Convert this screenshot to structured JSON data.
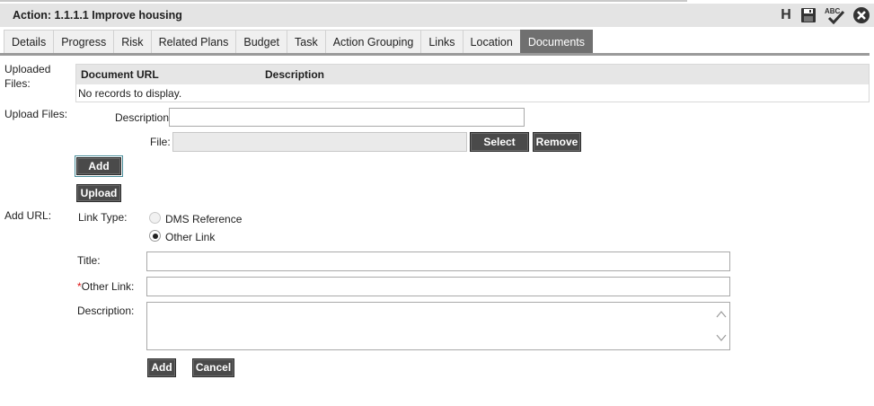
{
  "window": {
    "title": "Action: 1.1.1.1 Improve housing",
    "toolbar": {
      "h_label": "H"
    }
  },
  "tabs": [
    {
      "label": "Details"
    },
    {
      "label": "Progress"
    },
    {
      "label": "Risk"
    },
    {
      "label": "Related Plans"
    },
    {
      "label": "Budget"
    },
    {
      "label": "Task"
    },
    {
      "label": "Action Grouping"
    },
    {
      "label": "Links"
    },
    {
      "label": "Location"
    },
    {
      "label": "Documents",
      "active": true
    }
  ],
  "uploaded": {
    "label": "Uploaded Files:",
    "columns": [
      "Document URL",
      "Description"
    ],
    "empty_text": "No records to display."
  },
  "upload": {
    "label": "Upload Files:",
    "description_label": "Description:",
    "description_value": "",
    "file_label": "File:",
    "file_value": "",
    "select_label": "Select",
    "remove_label": "Remove",
    "add_label": "Add",
    "upload_label": "Upload"
  },
  "add_url": {
    "label": "Add URL:",
    "link_type_label": "Link Type:",
    "options": [
      {
        "label": "DMS Reference",
        "selected": false,
        "disabled": true
      },
      {
        "label": "Other Link",
        "selected": true,
        "disabled": false
      }
    ],
    "title_label": "Title:",
    "title_value": "",
    "required_mark": "*",
    "other_link_label": "Other Link:",
    "other_link_value": "",
    "description_label": "Description:",
    "description_value": "",
    "add_label": "Add",
    "cancel_label": "Cancel"
  }
}
